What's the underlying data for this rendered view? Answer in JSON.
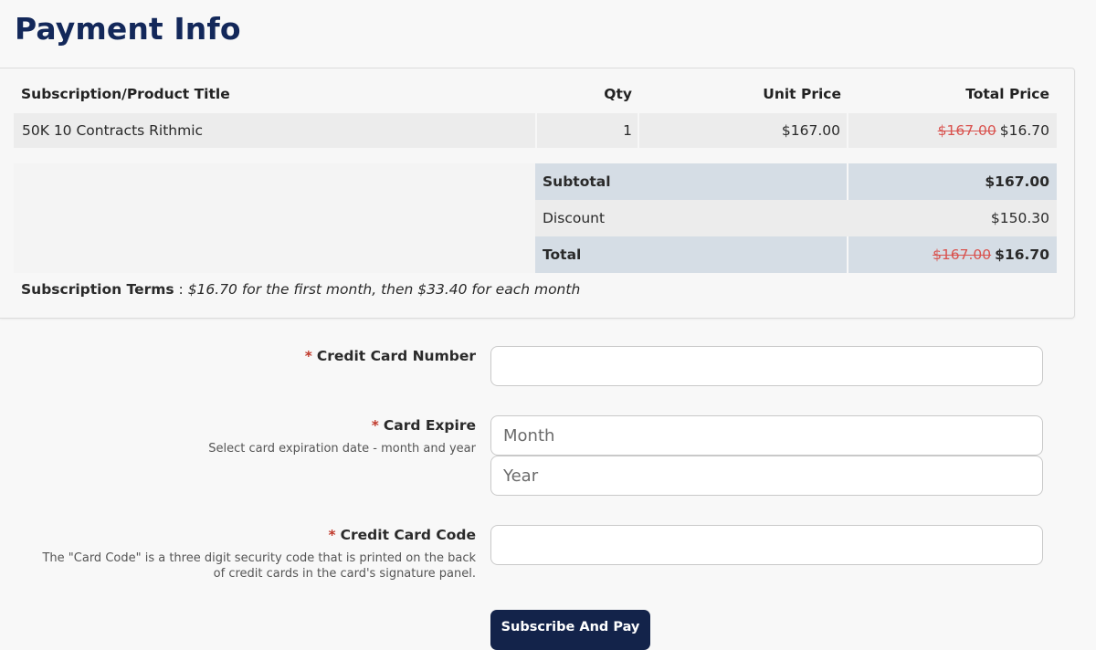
{
  "page": {
    "title": "Payment Info"
  },
  "order": {
    "headers": {
      "product": "Subscription/Product Title",
      "qty": "Qty",
      "unit_price": "Unit Price",
      "total_price": "Total Price"
    },
    "items": [
      {
        "title": "50K 10 Contracts Rithmic",
        "qty": "1",
        "unit_price": "$167.00",
        "total_original": "$167.00",
        "total_discounted": "$16.70"
      }
    ],
    "summary": {
      "subtotal_label": "Subtotal",
      "subtotal_value": "$167.00",
      "discount_label": "Discount",
      "discount_value": "$150.30",
      "total_label": "Total",
      "total_original": "$167.00",
      "total_discounted": "$16.70"
    },
    "terms": {
      "label": "Subscription Terms",
      "separator": " : ",
      "value": "$16.70 for the first month, then $33.40 for each month"
    }
  },
  "form": {
    "required_marker": "*",
    "card_number": {
      "label": "Credit Card Number",
      "value": "",
      "placeholder": ""
    },
    "card_expire": {
      "label": "Card Expire",
      "help": "Select card expiration date - month and year",
      "month_placeholder": "Month",
      "year_placeholder": "Year"
    },
    "card_code": {
      "label": "Credit Card Code",
      "help_line1": "The \"Card Code\" is a three digit security code that is printed on the back",
      "help_line2": "of credit cards in the card's signature panel.",
      "value": "",
      "placeholder": ""
    },
    "submit_label": "Subscribe And Pay"
  },
  "colors": {
    "title": "#13285a",
    "button": "#13234a",
    "strike": "#d9534f",
    "summary_header_bg": "#d5dde5",
    "row_bg": "#ececec",
    "required": "#c0392b"
  }
}
